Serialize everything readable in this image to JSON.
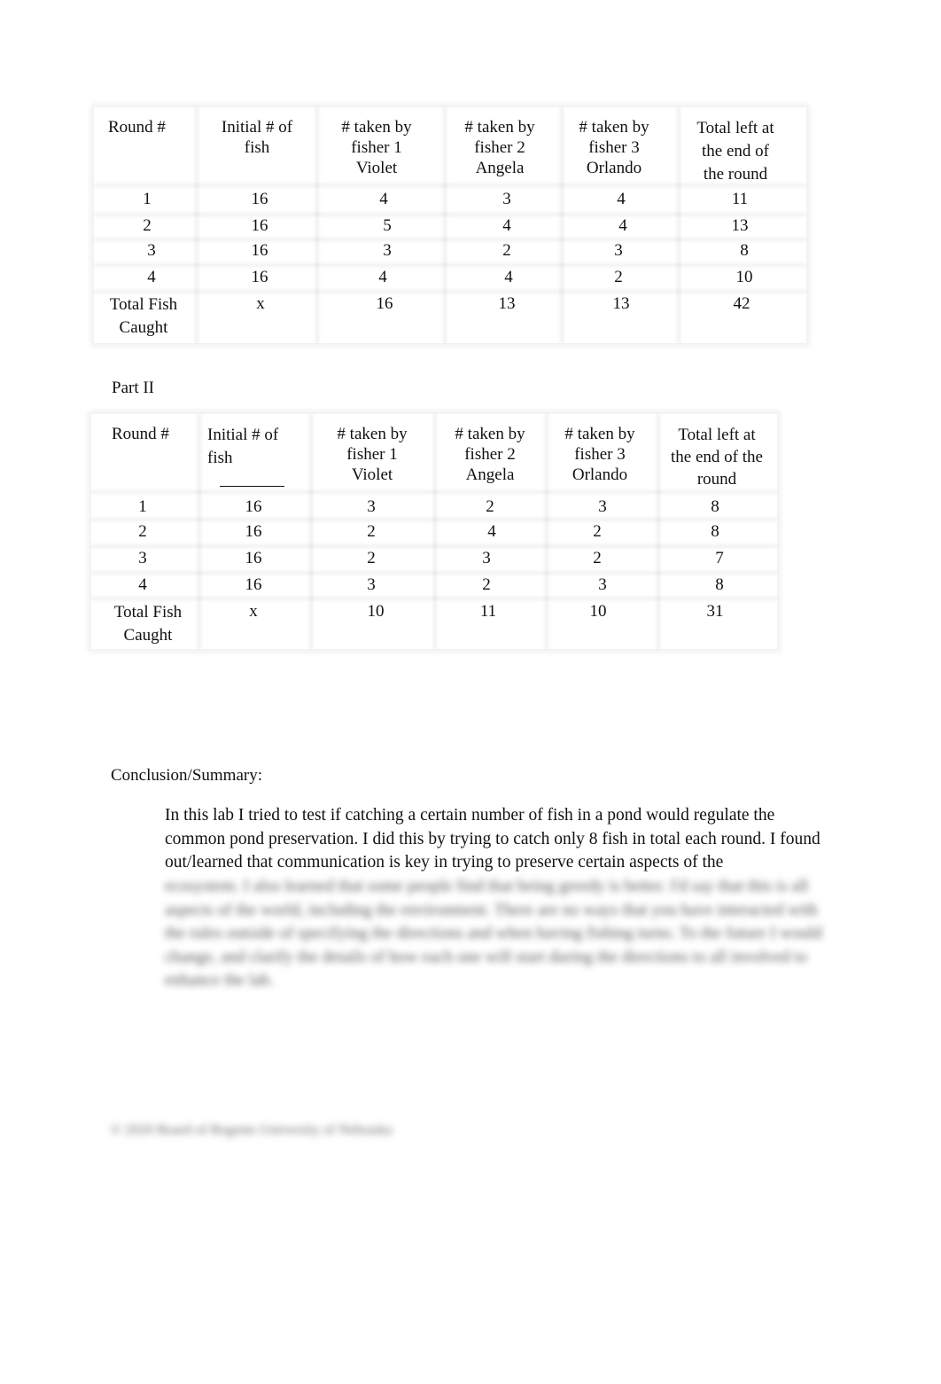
{
  "part1": {
    "headers": [
      "Round #",
      "Initial # of\nfish",
      "# taken by\nfisher 1\nViolet",
      "# taken by\nfisher 2\nAngela",
      "# taken by\nfisher 3\nOrlando",
      "Total left at\nthe end of\nthe round"
    ],
    "rows": [
      [
        "1",
        "16",
        "4",
        "3",
        "4",
        "11"
      ],
      [
        "2",
        "16",
        "5",
        "4",
        "4",
        "13"
      ],
      [
        "3",
        "16",
        "3",
        "2",
        "3",
        "8"
      ],
      [
        "4",
        "16",
        "4",
        "4",
        "2",
        "10"
      ],
      [
        "Total Fish\nCaught",
        "x",
        "16",
        "13",
        "13",
        "42"
      ]
    ]
  },
  "part2": {
    "title": "Part II",
    "headers": [
      "Round #",
      "Initial # of\nfish",
      "# taken by\nfisher 1\nViolet",
      "# taken by\nfisher 2\nAngela",
      "# taken by\nfisher 3\nOrlando",
      "Total left at\nthe end of the\nround"
    ],
    "rows": [
      [
        "1",
        "16",
        "3",
        "2",
        "3",
        "8"
      ],
      [
        "2",
        "16",
        "2",
        "4",
        "2",
        "8"
      ],
      [
        "3",
        "16",
        "2",
        "3",
        "2",
        "7"
      ],
      [
        "4",
        "16",
        "3",
        "2",
        "3",
        "8"
      ],
      [
        "Total Fish\nCaught",
        "x",
        "10",
        "11",
        "10",
        "31"
      ]
    ]
  },
  "conclusion": {
    "heading": "Conclusion/Summary:",
    "text": "In this lab I tried to test if catching a certain number of fish in a pond would regulate the common pond preservation. I did this by trying to catch only 8 fish in total each round. I found out/learned that communication is key in trying to preserve certain aspects of the",
    "blurred_text": "ecosystem. I also learned that some people find that being greedy is better. I'd say that this is all aspects of the world, including the environment. There are no ways that you have interacted with the rules outside of specifying the directions and when having fishing turns. To the future I would change, and clarify the details of how each one will start during the directions to all involved to enhance the lab."
  },
  "footer": {
    "text": "© 2020 Board of Regents University of Nebraska"
  }
}
